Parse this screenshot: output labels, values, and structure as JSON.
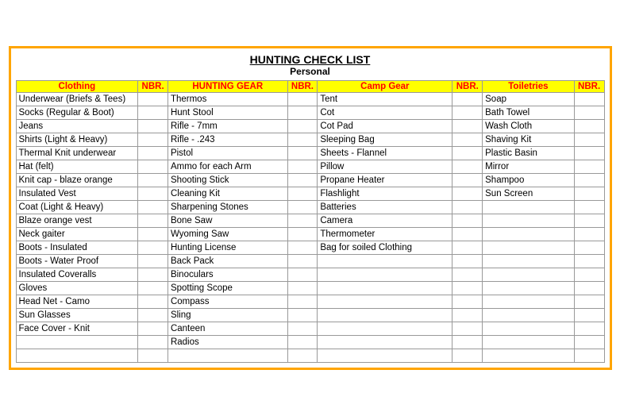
{
  "title": "HUNTING CHECK LIST",
  "subtitle": "Personal",
  "headers": {
    "clothing": "Clothing",
    "nbr1": "NBR.",
    "hunting_gear": "HUNTING GEAR",
    "nbr2": "NBR.",
    "camp_gear": "Camp Gear",
    "nbr3": "NBR.",
    "toiletries": "Toiletries",
    "nbr4": "NBR."
  },
  "rows": [
    {
      "clothing": "Underwear (Briefs & Tees)",
      "hunting_gear": "Thermos",
      "camp_gear": "Tent",
      "toiletries": "Soap"
    },
    {
      "clothing": "Socks (Regular & Boot)",
      "hunting_gear": "Hunt Stool",
      "camp_gear": "Cot",
      "toiletries": "Bath Towel"
    },
    {
      "clothing": "Jeans",
      "hunting_gear": "Rifle - 7mm",
      "camp_gear": "Cot Pad",
      "toiletries": "Wash Cloth"
    },
    {
      "clothing": "Shirts (Light & Heavy)",
      "hunting_gear": "Rifle - .243",
      "camp_gear": "Sleeping Bag",
      "toiletries": "Shaving Kit"
    },
    {
      "clothing": "Thermal Knit underwear",
      "hunting_gear": "Pistol",
      "camp_gear": "Sheets - Flannel",
      "toiletries": "Plastic Basin"
    },
    {
      "clothing": "Hat (felt)",
      "hunting_gear": "Ammo for each Arm",
      "camp_gear": "Pillow",
      "toiletries": "Mirror"
    },
    {
      "clothing": "Knit cap - blaze orange",
      "hunting_gear": "Shooting Stick",
      "camp_gear": "Propane Heater",
      "toiletries": "Shampoo"
    },
    {
      "clothing": "Insulated Vest",
      "hunting_gear": "Cleaning Kit",
      "camp_gear": "Flashlight",
      "toiletries": "Sun Screen"
    },
    {
      "clothing": "Coat (Light & Heavy)",
      "hunting_gear": "Sharpening Stones",
      "camp_gear": "Batteries",
      "toiletries": ""
    },
    {
      "clothing": "Blaze orange vest",
      "hunting_gear": "Bone Saw",
      "camp_gear": "Camera",
      "toiletries": ""
    },
    {
      "clothing": "Neck gaiter",
      "hunting_gear": "Wyoming Saw",
      "camp_gear": "Thermometer",
      "toiletries": ""
    },
    {
      "clothing": "Boots - Insulated",
      "hunting_gear": "Hunting License",
      "camp_gear": "Bag for soiled Clothing",
      "toiletries": ""
    },
    {
      "clothing": "Boots - Water Proof",
      "hunting_gear": "Back Pack",
      "camp_gear": "",
      "toiletries": ""
    },
    {
      "clothing": "Insulated Coveralls",
      "hunting_gear": "Binoculars",
      "camp_gear": "",
      "toiletries": ""
    },
    {
      "clothing": "Gloves",
      "hunting_gear": "Spotting Scope",
      "camp_gear": "",
      "toiletries": ""
    },
    {
      "clothing": "Head Net - Camo",
      "hunting_gear": "Compass",
      "camp_gear": "",
      "toiletries": ""
    },
    {
      "clothing": "Sun Glasses",
      "hunting_gear": "Sling",
      "camp_gear": "",
      "toiletries": ""
    },
    {
      "clothing": "Face Cover - Knit",
      "hunting_gear": "Canteen",
      "camp_gear": "",
      "toiletries": ""
    },
    {
      "clothing": "",
      "hunting_gear": "Radios",
      "camp_gear": "",
      "toiletries": ""
    },
    {
      "clothing": "",
      "hunting_gear": "",
      "camp_gear": "",
      "toiletries": ""
    }
  ]
}
